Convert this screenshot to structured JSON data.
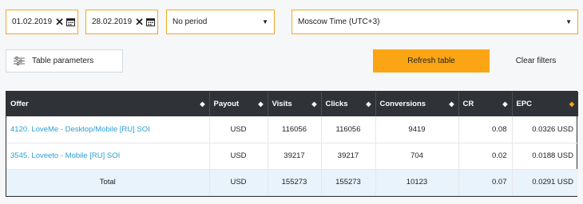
{
  "filters": {
    "date_from": "01.02.2019",
    "date_to": "28.02.2019",
    "period": "No period",
    "timezone": "Moscow Time (UTC+3)"
  },
  "actions": {
    "table_params": "Table parameters",
    "refresh": "Refresh table",
    "clear": "Clear filters"
  },
  "table": {
    "headers": [
      "Offer",
      "Payout",
      "Visits",
      "Clicks",
      "Conversions",
      "CR",
      "EPC"
    ],
    "rows": [
      [
        "4120. LoveMe - Desktop/Mobile [RU] SOI",
        "USD",
        "116056",
        "116056",
        "9419",
        "0.08",
        "0.0326 USD"
      ],
      [
        "3545. Loveeto - Mobile [RU] SOI",
        "USD",
        "39217",
        "39217",
        "704",
        "0.02",
        "0.0188 USD"
      ]
    ],
    "total": [
      "Total",
      "USD",
      "155273",
      "155273",
      "10123",
      "0.07",
      "0.0291 USD"
    ]
  },
  "colors": {
    "accent": "#fba515",
    "header_bg": "#2f3338",
    "link": "#2a9fd6",
    "total_bg": "#e9f3fb"
  }
}
